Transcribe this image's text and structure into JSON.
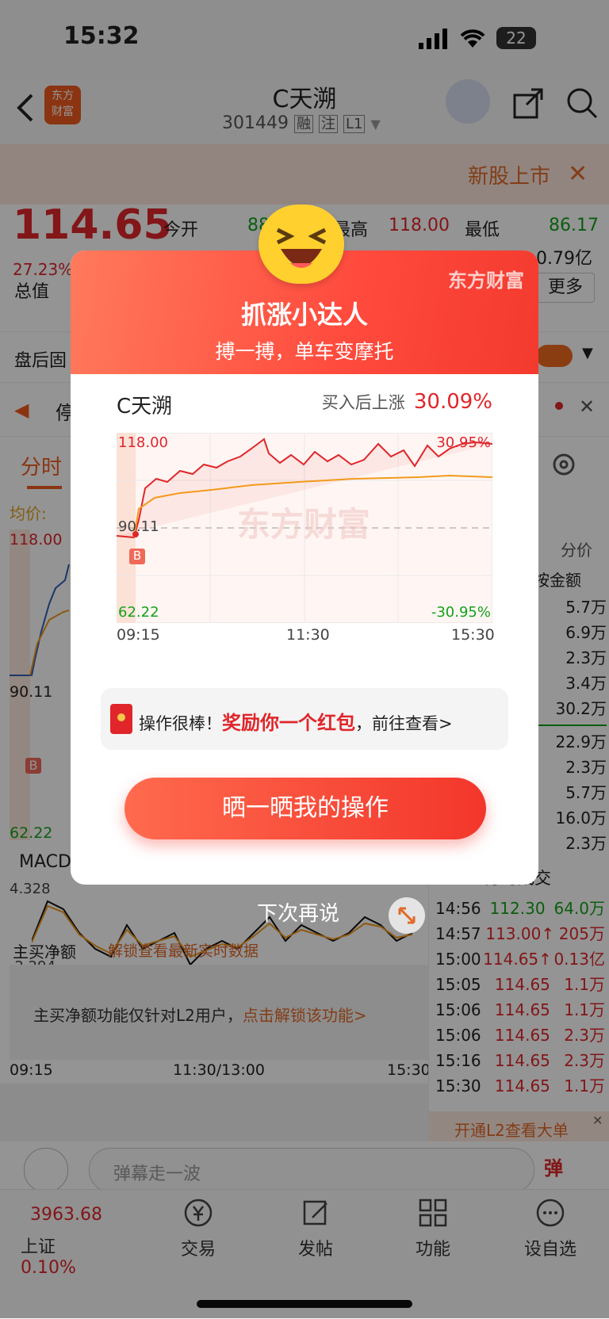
{
  "status": {
    "time": "15:32",
    "battery": "22"
  },
  "nav": {
    "logo_line1": "东方",
    "logo_line2": "财富",
    "title": "C天溯",
    "code": "301449",
    "tag1": "融",
    "tag2": "注",
    "tag3": "L1"
  },
  "banner": {
    "text": "新股上市"
  },
  "quote": {
    "price": "114.65",
    "change_pct": "27.23%",
    "open_label": "今开",
    "open_value": "88.xx",
    "high_label": "最高",
    "high_value": "118.00",
    "low_label": "最低",
    "low_value": "86.17",
    "amount_value": "0.79亿",
    "mktcap_label": "总值",
    "more_label": "更多",
    "afterhours_label": "盘后固"
  },
  "notice": {
    "text": "停"
  },
  "chart_tabs": {
    "tab1": "分时",
    "avg_label": "均价:"
  },
  "left_chart": {
    "top": "118.00",
    "mid": "90.11",
    "bottom": "62.22",
    "b": "B"
  },
  "macd": {
    "label": "MACD",
    "top": "4.328",
    "bottom": "-2.294"
  },
  "main_net": {
    "label": "主买净额",
    "unlock": "解锁查看最新实时数据",
    "msg": "主买净额功能仅针对L2用户，",
    "msg_link": "点击解锁该功能>"
  },
  "time_axis": {
    "t1": "09:15",
    "t2": "11:30/13:00",
    "t3": "15:30"
  },
  "right_panel": {
    "header": "分价",
    "sort": "按金额",
    "amounts": [
      "5.7万",
      "6.9万",
      "2.3万",
      "3.4万",
      "30.2万",
      "22.9万",
      "2.3万",
      "5.7万",
      "16.0万",
      "2.3万"
    ],
    "trades_label": "分时成交",
    "trades": [
      {
        "time": "14:56",
        "price": "112.30",
        "vol": "64.0万",
        "color": "green"
      },
      {
        "time": "14:57",
        "price": "113.00↑",
        "vol": "205万",
        "color": "red"
      },
      {
        "time": "15:00",
        "price": "114.65↑",
        "vol": "0.13亿",
        "color": "red"
      },
      {
        "time": "15:05",
        "price": "114.65",
        "vol": "1.1万",
        "color": "red"
      },
      {
        "time": "15:06",
        "price": "114.65",
        "vol": "1.1万",
        "color": "red"
      },
      {
        "time": "15:06",
        "price": "114.65",
        "vol": "2.3万",
        "color": "red"
      },
      {
        "time": "15:16",
        "price": "114.65",
        "vol": "2.3万",
        "color": "red"
      },
      {
        "time": "15:30",
        "price": "114.65",
        "vol": "1.1万",
        "color": "red"
      }
    ],
    "l2": "开通L2查看大单"
  },
  "comment": {
    "placeholder": "弹幕走一波",
    "btn": "弹"
  },
  "tabbar": {
    "index_value": "3963.68",
    "index_name": "上证",
    "index_pct": "0.10%",
    "trade": "交易",
    "post": "发帖",
    "func": "功能",
    "watch": "设自选"
  },
  "popup": {
    "brand": "东方财富",
    "title": "抓涨小达人",
    "subtitle": "搏一搏，单车变摩托",
    "stock": "C天溯",
    "gain_label": "买入后上涨",
    "gain_value": "30.09%",
    "top_price": "118.00",
    "top_pct": "30.95%",
    "mid_price": "90.11",
    "b": "B",
    "bottom_price": "62.22",
    "bottom_pct": "-30.95%",
    "x1": "09:15",
    "x2": "11:30",
    "x3": "15:30",
    "watermark": "东方财富",
    "reward_pre": "操作很棒！",
    "reward_main": "奖励你一个红包",
    "reward_post": "，前往查看>",
    "share": "晒一晒我的操作",
    "later": "下次再说"
  },
  "colors": {
    "red": "#e0262a",
    "green": "#13a31a",
    "brand_red": "#f33a2e",
    "orange": "#f39a1c"
  }
}
